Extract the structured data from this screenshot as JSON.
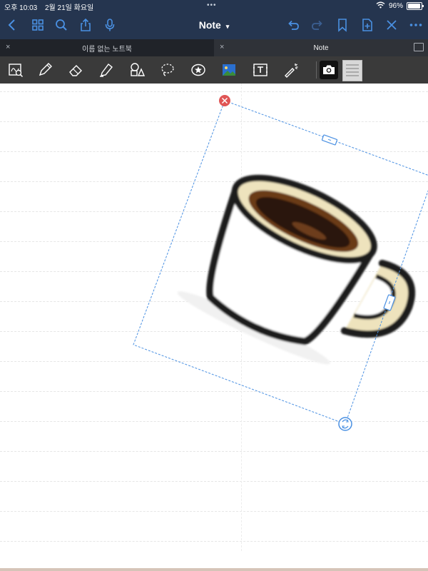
{
  "status": {
    "time": "오후 10:03",
    "date": "2월 21일 화요일",
    "battery": "96%",
    "battery_level": 0.96
  },
  "nav": {
    "title": "Note",
    "icons": [
      "chevron-left-icon",
      "grid-icon",
      "search-icon",
      "share-icon",
      "microphone-icon",
      "undo-icon",
      "redo-icon",
      "bookmark-icon",
      "add-page-icon",
      "close-icon",
      "more-icon"
    ]
  },
  "tabs": [
    {
      "label": "이름 없는 노트북",
      "close": "×"
    },
    {
      "label": "Note",
      "close": "×"
    }
  ],
  "toolbar": {
    "tools": [
      "lasso-zoom-icon",
      "pen-icon",
      "eraser-icon",
      "highlighter-icon",
      "shapes-icon",
      "lasso-icon",
      "sticker-icon",
      "image-icon",
      "text-icon",
      "laser-pointer-icon",
      "camera-icon"
    ]
  },
  "colors": {
    "nav_bg": "#25354f",
    "accent": "#4a90e2",
    "toolbar_bg": "#3a3a3a",
    "delete": "#e05555"
  }
}
